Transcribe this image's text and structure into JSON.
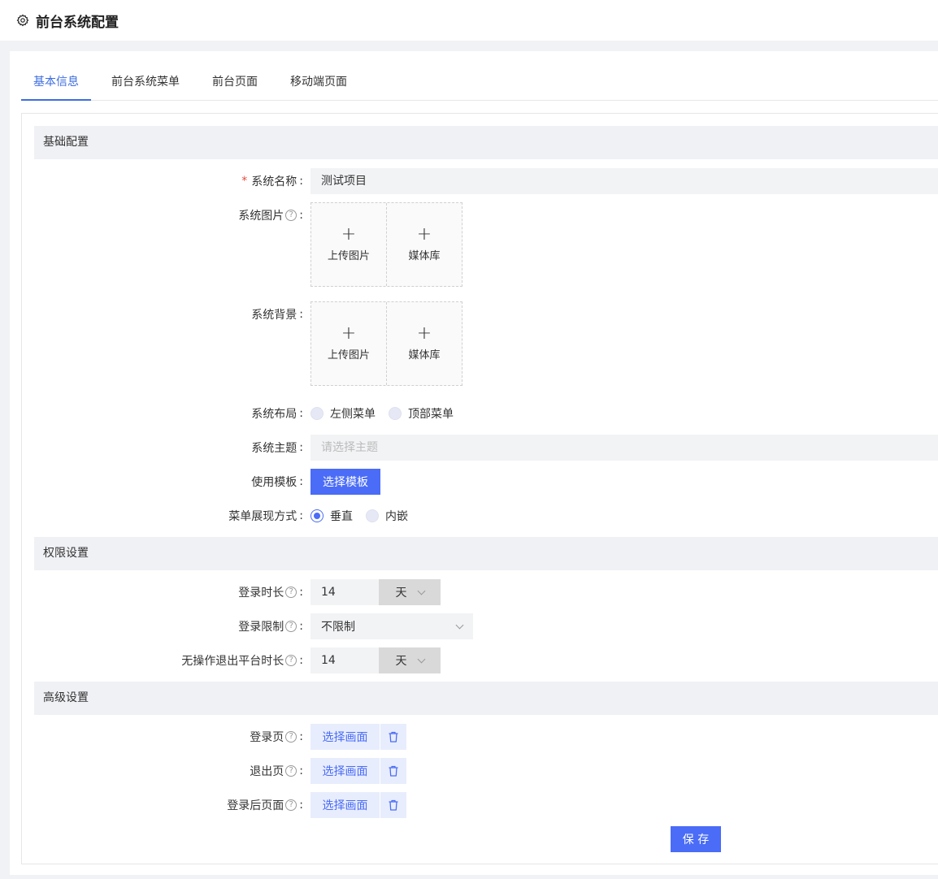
{
  "header": {
    "title": "前台系统配置",
    "icon": "gear-icon"
  },
  "tabs": [
    {
      "label": "基本信息",
      "active": true
    },
    {
      "label": "前台系统菜单",
      "active": false
    },
    {
      "label": "前台页面",
      "active": false
    },
    {
      "label": "移动端页面",
      "active": false
    }
  ],
  "basic": {
    "section_title": "基础配置",
    "name_label": "系统名称",
    "name_value": "测试项目",
    "image_label": "系统图片",
    "bg_label": "系统背景",
    "upload_label": "上传图片",
    "media_label": "媒体库",
    "layout_label": "系统布局",
    "layout_options": [
      "左侧菜单",
      "顶部菜单"
    ],
    "theme_label": "系统主题",
    "theme_placeholder": "请选择主题",
    "template_label": "使用模板",
    "template_button": "选择模板",
    "menu_mode_label": "菜单展现方式",
    "menu_mode_options": [
      "垂直",
      "内嵌"
    ],
    "menu_mode_selected": "垂直"
  },
  "permission": {
    "section_title": "权限设置",
    "login_duration_label": "登录时长",
    "login_duration_value": "14",
    "login_duration_unit": "天",
    "login_limit_label": "登录限制",
    "login_limit_value": "不限制",
    "idle_label": "无操作退出平台时长",
    "idle_value": "14",
    "idle_unit": "天"
  },
  "advanced": {
    "section_title": "高级设置",
    "login_page_label": "登录页",
    "logout_page_label": "退出页",
    "after_login_label": "登录后页面",
    "pick_button": "选择画面"
  },
  "colon": ":",
  "save_button": "保 存",
  "colors": {
    "accent": "#4a6cf7",
    "required": "#e74c3c"
  }
}
